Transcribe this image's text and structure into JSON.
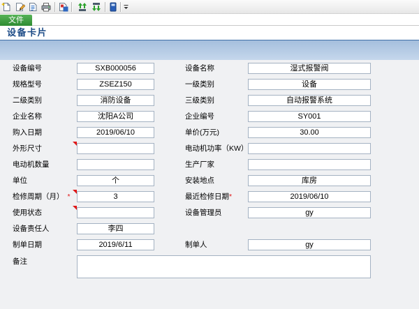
{
  "toolbar": {
    "icons": [
      "new-document-icon",
      "edit-pencil-icon",
      "document-icon",
      "printer-icon",
      "export-document-icon",
      "green-arrows-up-icon",
      "green-arrows-down-icon",
      "blue-book-icon",
      "dropdown-arrow-icon"
    ]
  },
  "menu": {
    "file_tab": "文件"
  },
  "page_title": "设备卡片",
  "form": {
    "equipment_code": {
      "label": "设备编号",
      "value": "SXB000056"
    },
    "equipment_name": {
      "label": "设备名称",
      "value": "湿式报警阀"
    },
    "spec_model": {
      "label": "规格型号",
      "value": "ZSEZ150"
    },
    "category_level1": {
      "label": "一级类别",
      "value": "设备"
    },
    "category_level2": {
      "label": "二级类别",
      "value": "消防设备"
    },
    "category_level3": {
      "label": "三级类别",
      "value": "自动报警系统"
    },
    "company_name": {
      "label": "企业名称",
      "value": "沈阳A公司"
    },
    "company_code": {
      "label": "企业编号",
      "value": "SY001"
    },
    "purchase_date": {
      "label": "购入日期",
      "value": "2019/06/10"
    },
    "unit_price": {
      "label": "单价(万元)",
      "value": "30.00"
    },
    "dimensions": {
      "label": "外形尺寸",
      "value": ""
    },
    "motor_power": {
      "label": "电动机功率（KW）",
      "value": ""
    },
    "motor_count": {
      "label": "电动机数量",
      "value": ""
    },
    "manufacturer": {
      "label": "生产厂家",
      "value": ""
    },
    "unit": {
      "label": "单位",
      "value": "个"
    },
    "install_location": {
      "label": "安装地点",
      "value": "库房"
    },
    "maintenance_cycle": {
      "label": "检修周期（月）",
      "required_mark": "*",
      "value": "3"
    },
    "last_maintenance_date": {
      "label": "最近检修日期",
      "required_mark": "*",
      "value": "2019/06/10"
    },
    "usage_status": {
      "label": "使用状态",
      "value": ""
    },
    "equipment_admin": {
      "label": "设备管理员",
      "value": "gy"
    },
    "responsible_person": {
      "label": "设备责任人",
      "value": "李四"
    },
    "created_date": {
      "label": "制单日期",
      "value": "2019/6/11"
    },
    "creator": {
      "label": "制单人",
      "value": "gy"
    },
    "remarks": {
      "label": "备注",
      "value": ""
    }
  },
  "colors": {
    "file_tab_bg": "#2e8b32",
    "title_text": "#1b4a86",
    "header_band": "#b5cbe5",
    "required_marker": "#e01818",
    "form_bg": "#f0f1f3"
  }
}
